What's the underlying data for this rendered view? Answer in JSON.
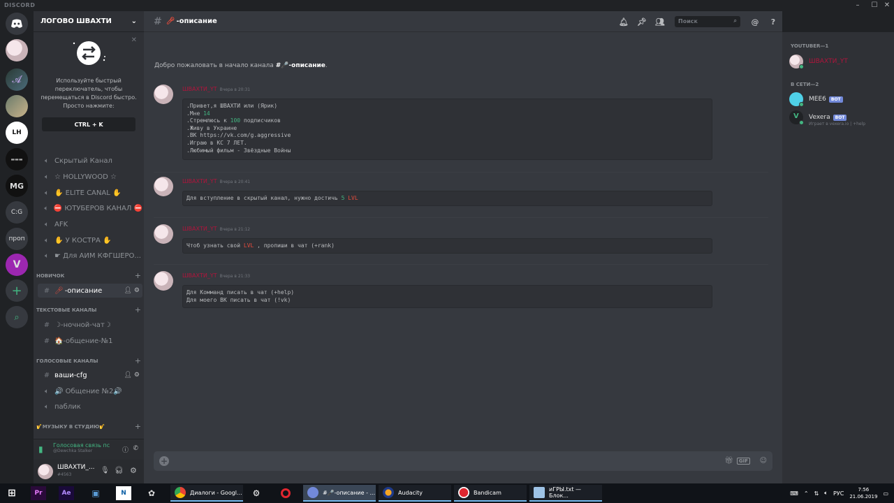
{
  "app": {
    "brand": "DISCORD"
  },
  "window_controls": {
    "minimize": "–",
    "maximize": "☐",
    "close": "✕"
  },
  "servers": [
    {
      "label": "",
      "icon": "discord-home"
    },
    {
      "label": "",
      "icon": "avatar"
    },
    {
      "label": "",
      "icon": "avatar"
    },
    {
      "label": "",
      "icon": "avatar"
    },
    {
      "label": "LH",
      "icon": "text"
    },
    {
      "label": "",
      "icon": "text"
    },
    {
      "label": "MG",
      "icon": "text"
    },
    {
      "label": "C:G",
      "icon": "text"
    },
    {
      "label": "проп",
      "icon": "text"
    },
    {
      "label": "V",
      "icon": "text"
    }
  ],
  "guild": {
    "name": "ЛОГОВО ШВАХТИ"
  },
  "switcher_tip": {
    "text": "Используйте быстрый переключатель, чтобы перемещаться в Discord быстро. Просто нажмите:",
    "shortcut": "CTRL + K"
  },
  "voice_channels_top": [
    "Скрытый Канал",
    "☆ HOLLYWOOD ☆",
    "✋ ELITE CANAL ✋",
    "⛔ ЮТУБЕРОВ КАНАЛ ⛔",
    "AFK",
    "✋ У КОСТРА ✋",
    "☛ Для АИМ КФГШЕРО..."
  ],
  "categories": {
    "novichok": "НОВИЧОК",
    "text": "ТЕКСТОВЫЕ КАНАЛЫ",
    "voice": "ГОЛОСОВЫЕ КАНАЛЫ",
    "music": "🎷МУЗЫКУ В СТУДИЮ🎷"
  },
  "channels": {
    "description": "-описание",
    "night_chat": "☽-ночной-чат☽",
    "general": "🏠-общение-№1",
    "cfg": "ваши-cfg",
    "general2": "🔊 Общение №2🔊",
    "public": "паблик"
  },
  "voice_status": {
    "title": "Голосовая связь пс",
    "subtitle": "@Dewchka Stalker"
  },
  "user": {
    "name": "ШВАХТИ_...",
    "tag": "#4563"
  },
  "chat": {
    "channel": "-описание",
    "search_placeholder": "Поиск",
    "welcome_prefix": "Добро пожаловать в начало канала",
    "welcome_channel": "#🎤-описание",
    "composer_placeholder": ""
  },
  "messages": [
    {
      "author": "ШВАХТИ_YT",
      "time": "Вчера в 20:31",
      "lines": [
        ".Привет,я ШВАХТИ или (Ярик)",
        ".Мне 14",
        ".Стремлюсь к 100 подписчиков",
        ".Живу в Украине",
        ".ВК https://vk.com/g.aggressive",
        ".Играю в КС 7 ЛЕТ.",
        ".Любимый фильм - Звёздные Войны"
      ]
    },
    {
      "author": "ШВАХТИ_YT",
      "time": "Вчера в 20:41",
      "lines": [
        "Для вступление в скрытый канал, нужно достичь 5 LVL"
      ]
    },
    {
      "author": "ШВАХТИ_YT",
      "time": "Вчера в 21:12",
      "lines": [
        "Чтоб узнать свой LVL , пропиши в чат (+rank)"
      ]
    },
    {
      "author": "ШВАХТИ_YT",
      "time": "Вчера в 21:33",
      "lines": [
        "Для Комманд писать в чат (+help)",
        "Для моего ВК писать в чат (!vk)"
      ]
    }
  ],
  "members": {
    "cat_youtuber": "YOUTUBER—1",
    "cat_online": "В СЕТИ—2",
    "list": [
      {
        "name": "ШВАХТИ_YT",
        "color": "#b1143c",
        "bot": false,
        "sub": ""
      },
      {
        "name": "MEE6",
        "color": "#dcddde",
        "bot": true,
        "sub": ""
      },
      {
        "name": "Vexera",
        "color": "#dcddde",
        "bot": true,
        "sub": "Играет в vexera.io | +help"
      }
    ],
    "bot_label": "BOT"
  },
  "taskbar": {
    "tasks": [
      "Диалоги - Googl...",
      "#🎤-описание - ...",
      "Audacity",
      "Bandicam",
      "иГРЫ.txt — Блок..."
    ],
    "lang": "РУС",
    "time": "7:56",
    "date": "21.06.2019"
  },
  "colors": {
    "accent": "#7289da",
    "online": "#43b581",
    "owner_name": "#b1143c"
  }
}
